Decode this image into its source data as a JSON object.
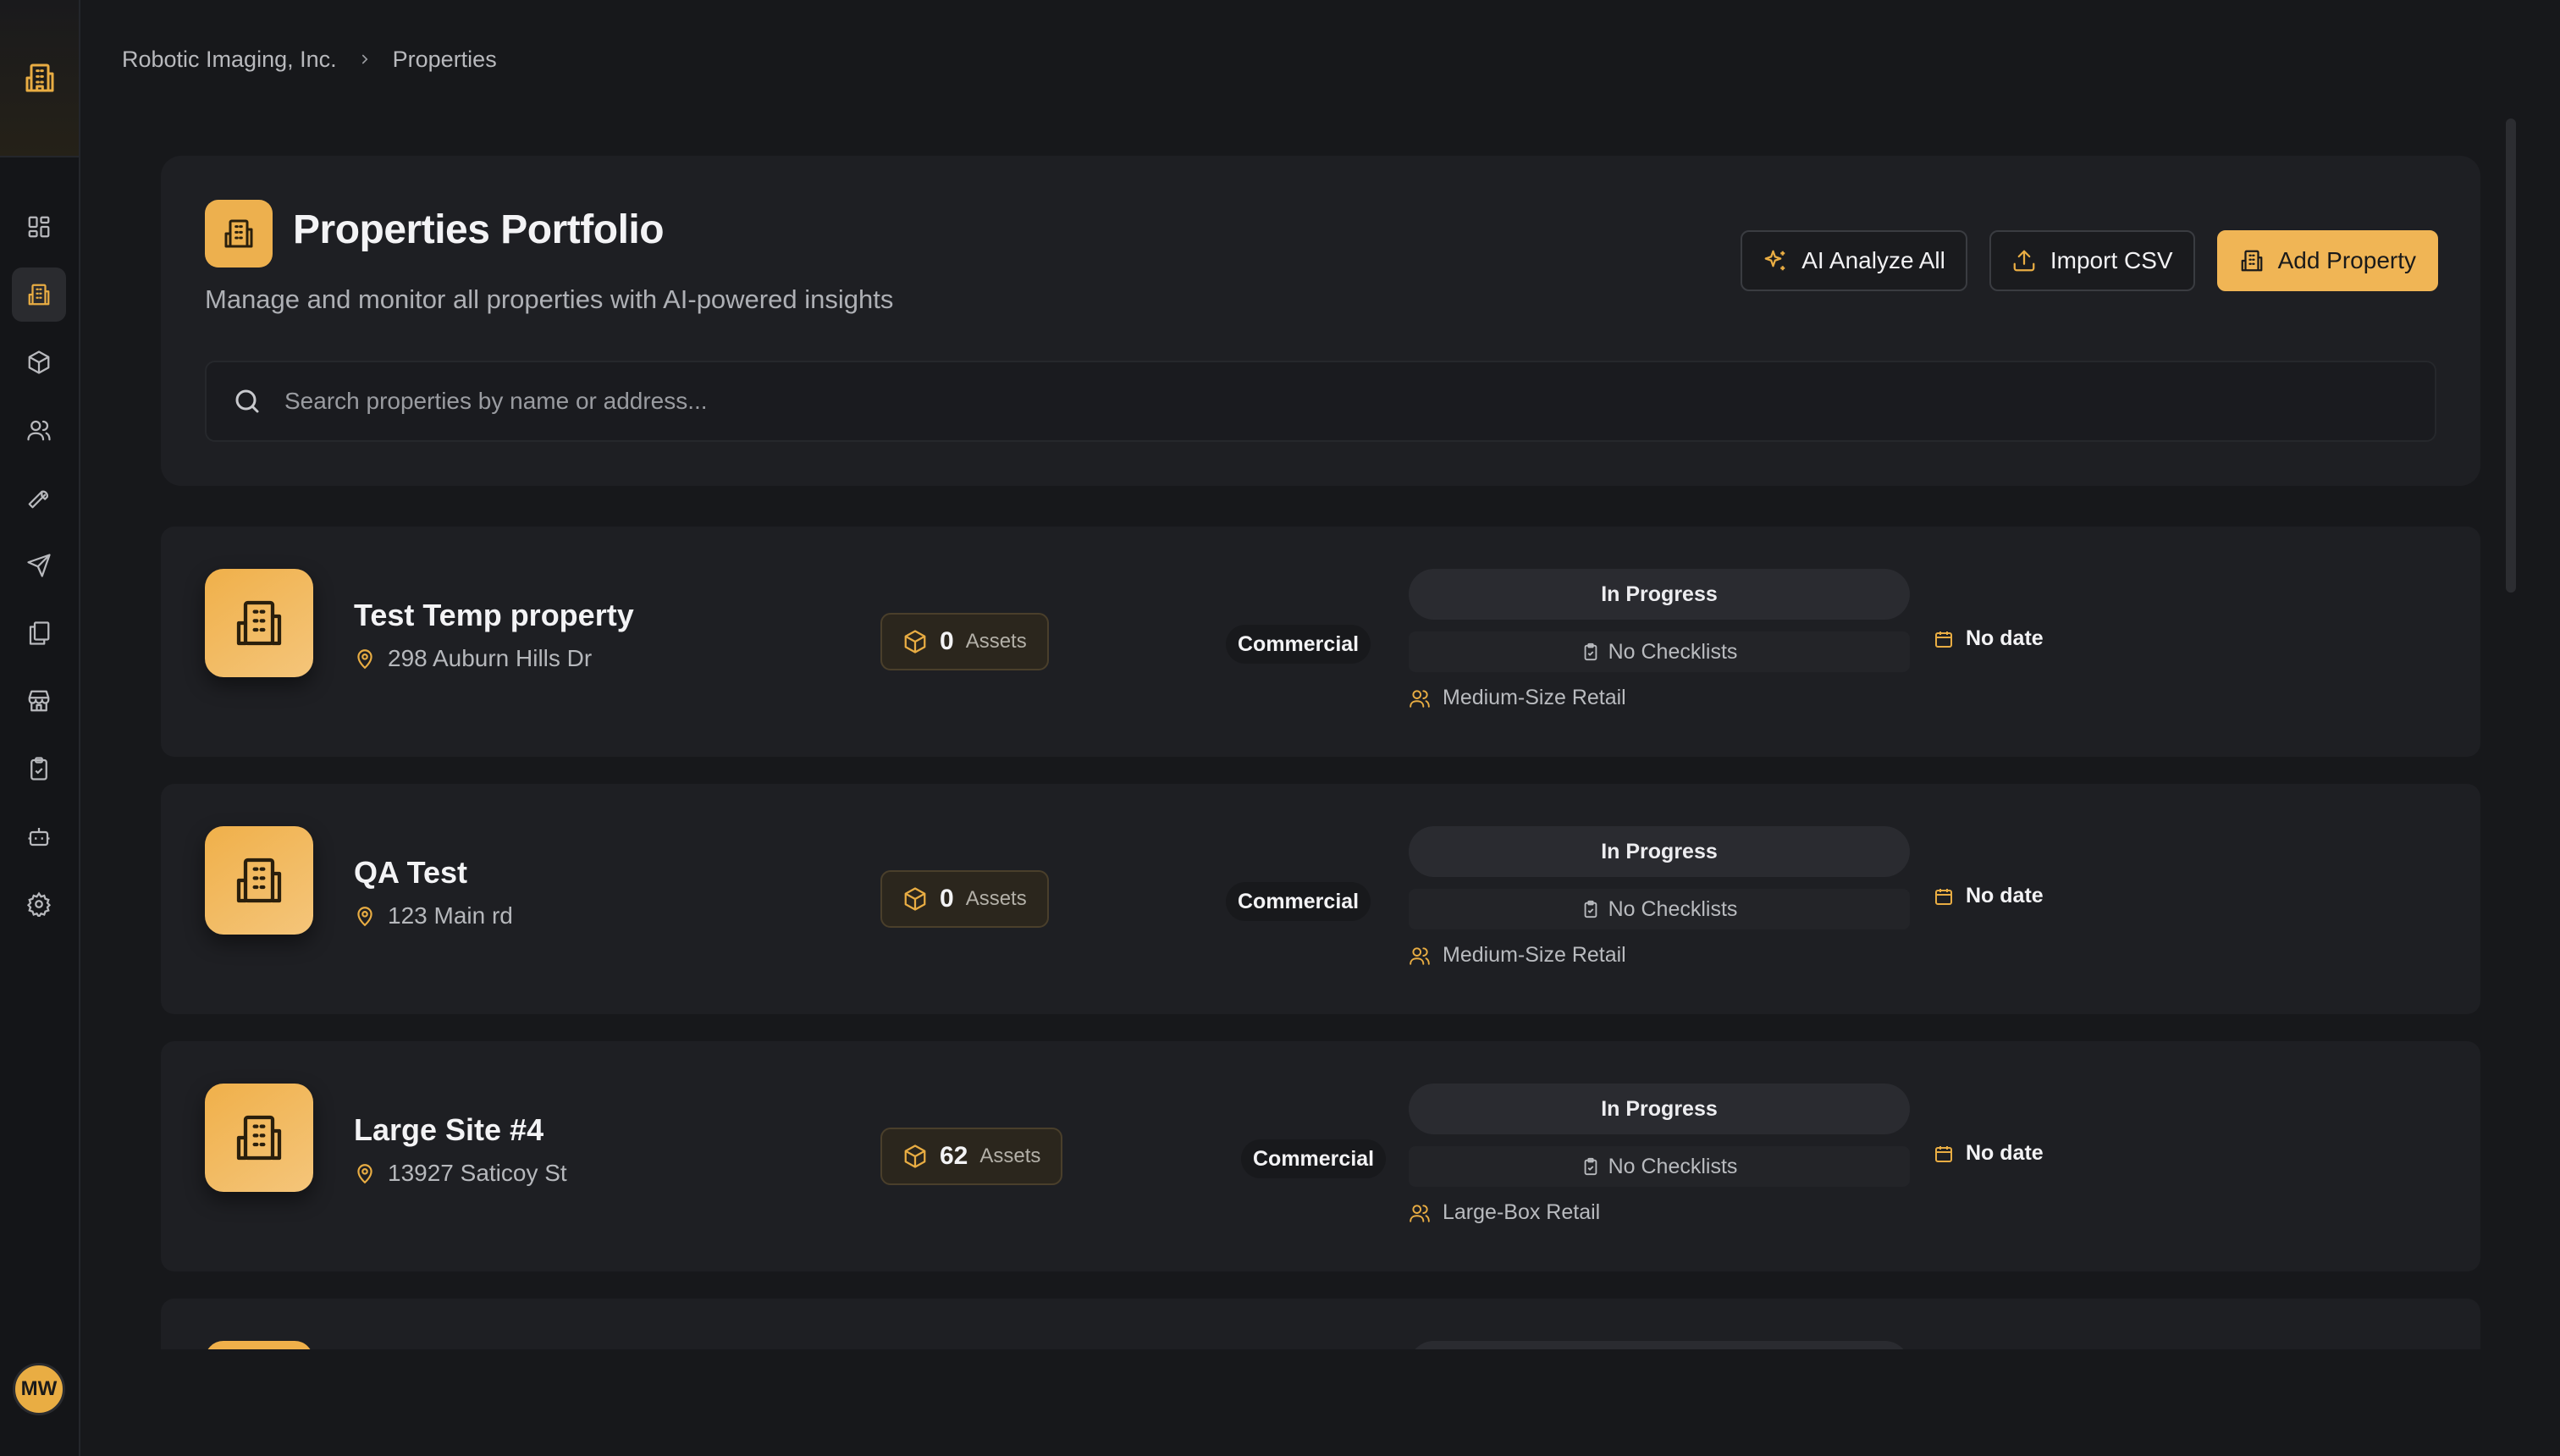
{
  "breadcrumb": {
    "org": "Robotic Imaging, Inc.",
    "current": "Properties"
  },
  "user": {
    "initials": "MW"
  },
  "sidebar": {
    "items": [
      {
        "icon": "dashboard-icon"
      },
      {
        "icon": "building-icon",
        "active": true
      },
      {
        "icon": "box-icon"
      },
      {
        "icon": "users-icon"
      },
      {
        "icon": "wrench-icon"
      },
      {
        "icon": "send-icon"
      },
      {
        "icon": "documents-icon"
      },
      {
        "icon": "store-icon"
      },
      {
        "icon": "clipboard-icon"
      },
      {
        "icon": "bot-icon"
      },
      {
        "icon": "gear-icon"
      }
    ]
  },
  "header": {
    "title": "Properties Portfolio",
    "subtitle": "Manage and monitor all properties with AI-powered insights",
    "actions": {
      "ai_analyze": "AI Analyze All",
      "import_csv": "Import CSV",
      "add_property": "Add Property"
    },
    "search_placeholder": "Search properties by name or address..."
  },
  "properties": [
    {
      "name": "Test Temp property",
      "address": "298 Auburn Hills Dr",
      "assets_count": "0",
      "assets_label": "Assets",
      "type": "Commercial",
      "status": "In Progress",
      "checklists": "No Checklists",
      "category": "Medium-Size Retail",
      "date": "No date"
    },
    {
      "name": "QA Test",
      "address": "123 Main rd",
      "assets_count": "0",
      "assets_label": "Assets",
      "type": "Commercial",
      "status": "In Progress",
      "checklists": "No Checklists",
      "category": "Medium-Size Retail",
      "date": "No date"
    },
    {
      "name": "Large Site #4",
      "address": "13927 Saticoy St",
      "assets_count": "62",
      "assets_label": "Assets",
      "type": "Commercial",
      "status": "In Progress",
      "checklists": "No Checklists",
      "category": "Large-Box Retail",
      "date": "No date"
    }
  ],
  "colors": {
    "accent": "#f0b555",
    "background": "#17181b",
    "panel": "#1e1f23"
  }
}
